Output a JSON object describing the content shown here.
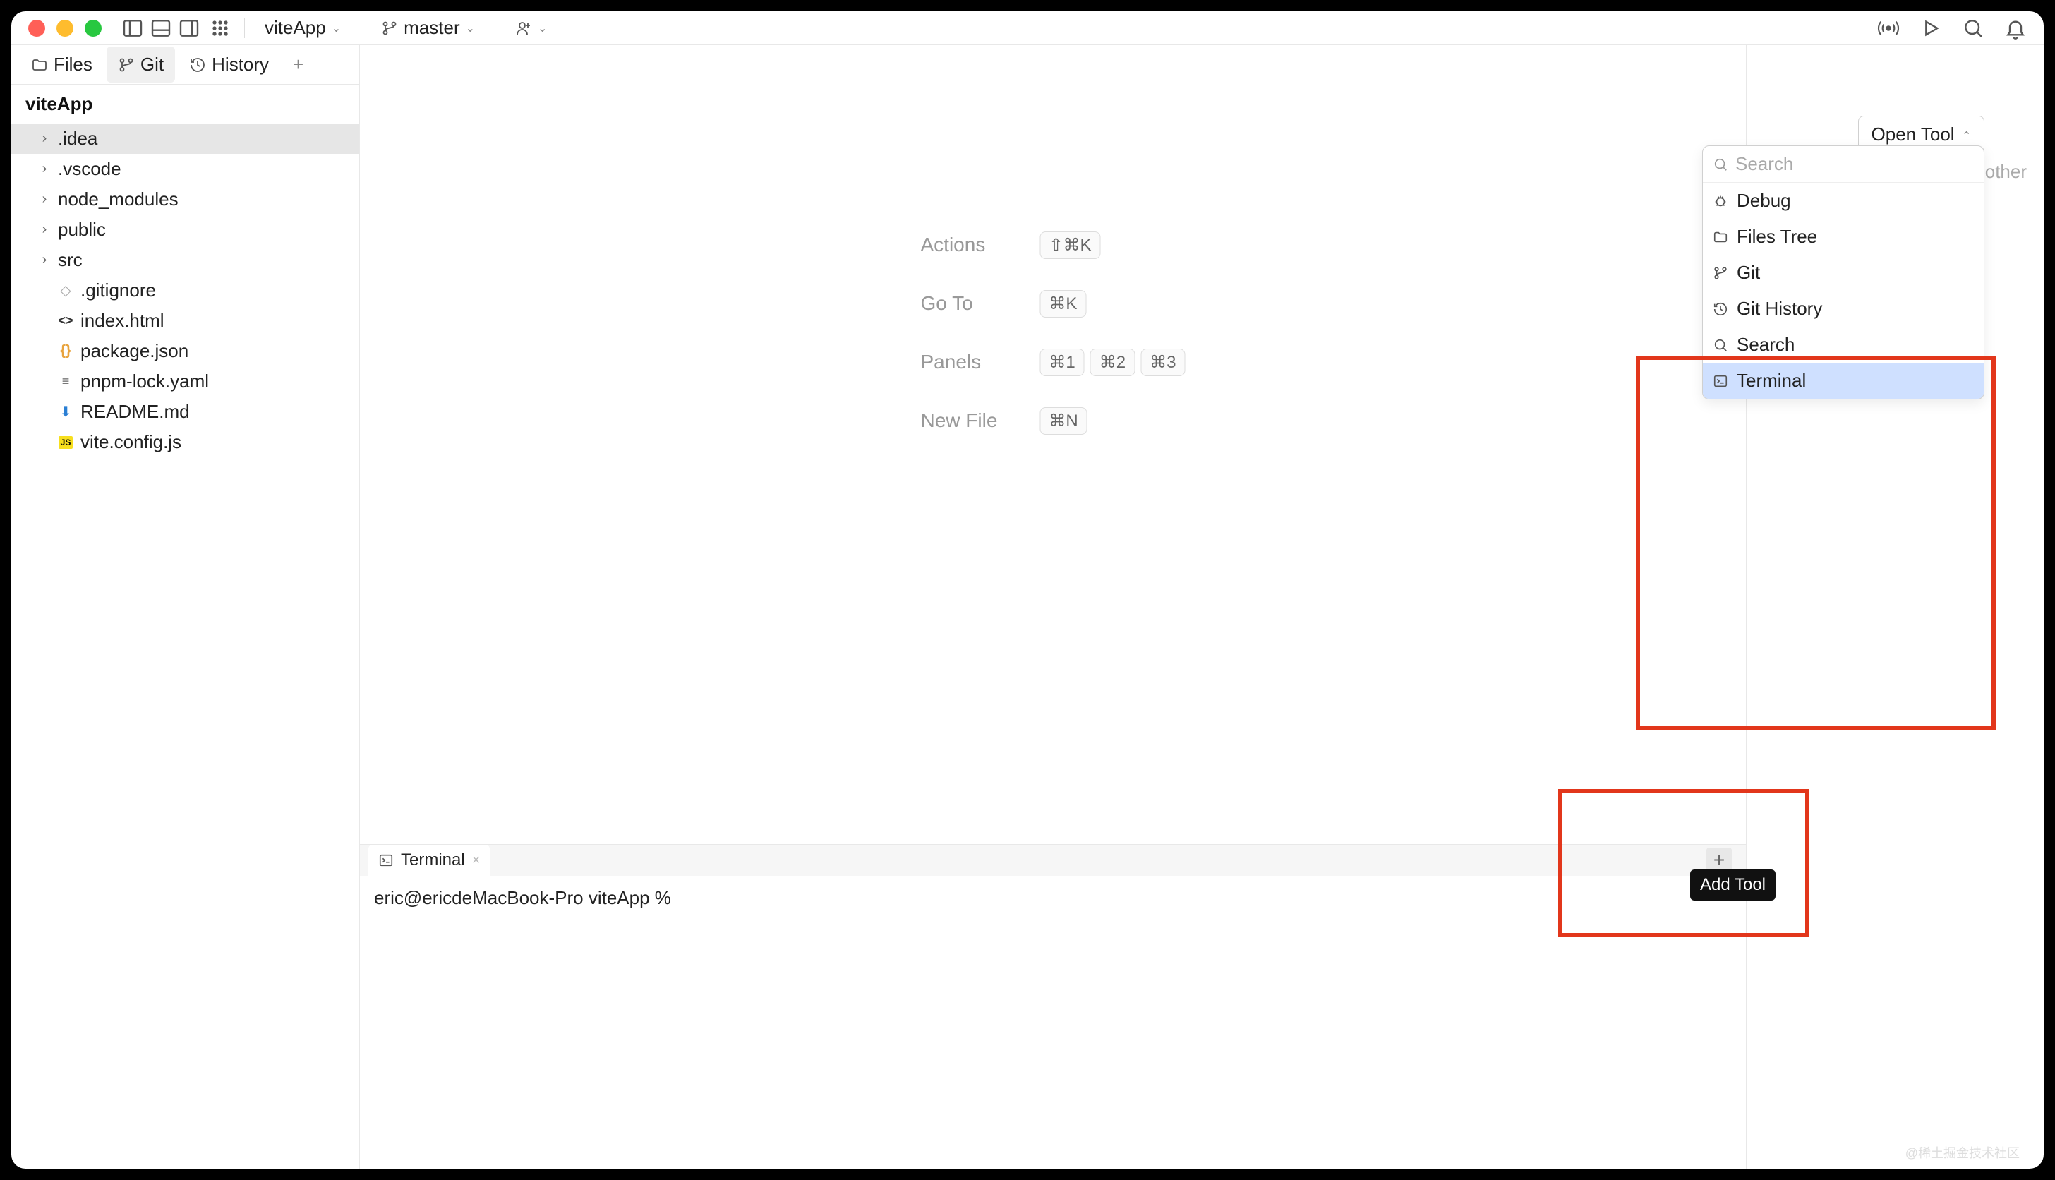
{
  "titlebar": {
    "project": "viteApp",
    "branch": "master"
  },
  "sidebar": {
    "tabs": [
      {
        "label": "Files",
        "icon": "folder-icon",
        "active": false
      },
      {
        "label": "Git",
        "icon": "git-branch-icon",
        "active": true
      },
      {
        "label": "History",
        "icon": "history-icon",
        "active": false
      }
    ],
    "projectName": "viteApp",
    "tree": [
      {
        "name": ".idea",
        "kind": "folder",
        "selected": true
      },
      {
        "name": ".vscode",
        "kind": "folder"
      },
      {
        "name": "node_modules",
        "kind": "folder"
      },
      {
        "name": "public",
        "kind": "folder"
      },
      {
        "name": "src",
        "kind": "folder"
      },
      {
        "name": ".gitignore",
        "kind": "file",
        "icon": "git-ignore-icon"
      },
      {
        "name": "index.html",
        "kind": "file",
        "icon": "html-icon"
      },
      {
        "name": "package.json",
        "kind": "file",
        "icon": "json-icon"
      },
      {
        "name": "pnpm-lock.yaml",
        "kind": "file",
        "icon": "yaml-icon"
      },
      {
        "name": "README.md",
        "kind": "file",
        "icon": "markdown-icon"
      },
      {
        "name": "vite.config.js",
        "kind": "file",
        "icon": "js-icon"
      }
    ]
  },
  "editor_hints": {
    "rows": [
      {
        "label": "Actions",
        "shortcuts": [
          "⇧⌘K"
        ]
      },
      {
        "label": "Go To",
        "shortcuts": [
          "⌘K"
        ]
      },
      {
        "label": "Panels",
        "shortcuts": [
          "⌘1",
          "⌘2",
          "⌘3"
        ]
      },
      {
        "label": "New File",
        "shortcuts": [
          "⌘N"
        ]
      }
    ]
  },
  "terminal": {
    "tab_label": "Terminal",
    "prompt": "eric@ericdeMacBook-Pro viteApp %"
  },
  "open_tool": {
    "button_label": "Open Tool",
    "search_placeholder": "Search",
    "other_label": "other",
    "items": [
      {
        "label": "Debug",
        "icon": "bug-icon"
      },
      {
        "label": "Files Tree",
        "icon": "folder-icon"
      },
      {
        "label": "Git",
        "icon": "git-branch-icon"
      },
      {
        "label": "Git History",
        "icon": "history-icon"
      },
      {
        "label": "Search",
        "icon": "search-icon"
      },
      {
        "label": "Terminal",
        "icon": "terminal-icon",
        "selected": true
      }
    ]
  },
  "tooltip": {
    "add_tool": "Add Tool"
  },
  "watermark": "@稀土掘金技术社区"
}
